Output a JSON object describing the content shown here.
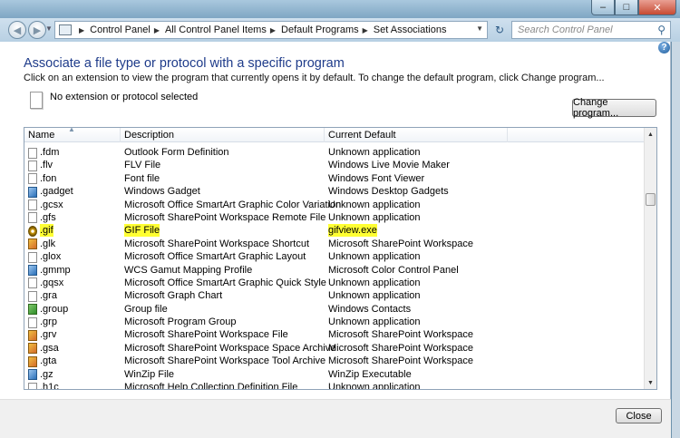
{
  "window": {
    "minimize_icon": "minimize-icon",
    "maximize_icon": "maximize-icon",
    "close_icon": "close-icon"
  },
  "address_bar": {
    "breadcrumbs": [
      "Control Panel",
      "All Control Panel Items",
      "Default Programs",
      "Set Associations"
    ],
    "search_placeholder": "Search Control Panel"
  },
  "page": {
    "heading": "Associate a file type or protocol with a specific program",
    "instructions": "Click on an extension to view the program that currently opens it by default. To change the default program, click Change program...",
    "selection_text": "No extension or protocol selected",
    "change_button": "Change program...",
    "close_button": "Close"
  },
  "list": {
    "columns": [
      "Name",
      "Description",
      "Current Default"
    ],
    "rows": [
      {
        "name": ".fdm",
        "description": "Outlook Form Definition",
        "default": "Unknown application",
        "icon": "plain"
      },
      {
        "name": ".flv",
        "description": "FLV File",
        "default": "Windows Live Movie Maker",
        "icon": "plain"
      },
      {
        "name": ".fon",
        "description": "Font file",
        "default": "Windows Font Viewer",
        "icon": "plain"
      },
      {
        "name": ".gadget",
        "description": "Windows Gadget",
        "default": "Windows Desktop Gadgets",
        "icon": "blue"
      },
      {
        "name": ".gcsx",
        "description": "Microsoft Office SmartArt Graphic Color Variation",
        "default": "Unknown application",
        "icon": "plain"
      },
      {
        "name": ".gfs",
        "description": "Microsoft SharePoint Workspace Remote File",
        "default": "Unknown application",
        "icon": "plain"
      },
      {
        "name": ".gif",
        "description": "GIF File",
        "default": "gifview.exe",
        "icon": "gif",
        "highlighted": true
      },
      {
        "name": ".glk",
        "description": "Microsoft SharePoint Workspace Shortcut",
        "default": "Microsoft SharePoint Workspace",
        "icon": "color"
      },
      {
        "name": ".glox",
        "description": "Microsoft Office SmartArt Graphic Layout",
        "default": "Unknown application",
        "icon": "plain"
      },
      {
        "name": ".gmmp",
        "description": "WCS Gamut Mapping Profile",
        "default": "Microsoft Color Control Panel",
        "icon": "blue"
      },
      {
        "name": ".gqsx",
        "description": "Microsoft Office SmartArt Graphic Quick Style",
        "default": "Unknown application",
        "icon": "plain"
      },
      {
        "name": ".gra",
        "description": "Microsoft Graph Chart",
        "default": "Unknown application",
        "icon": "plain"
      },
      {
        "name": ".group",
        "description": "Group file",
        "default": "Windows Contacts",
        "icon": "green"
      },
      {
        "name": ".grp",
        "description": "Microsoft Program Group",
        "default": "Unknown application",
        "icon": "plain"
      },
      {
        "name": ".grv",
        "description": "Microsoft SharePoint Workspace File",
        "default": "Microsoft SharePoint Workspace",
        "icon": "color"
      },
      {
        "name": ".gsa",
        "description": "Microsoft SharePoint Workspace Space Archive",
        "default": "Microsoft SharePoint Workspace",
        "icon": "color"
      },
      {
        "name": ".gta",
        "description": "Microsoft SharePoint Workspace Tool Archive",
        "default": "Microsoft SharePoint Workspace",
        "icon": "color"
      },
      {
        "name": ".gz",
        "description": "WinZip File",
        "default": "WinZip Executable",
        "icon": "blue"
      },
      {
        "name": ".h1c",
        "description": "Microsoft Help Collection Definition File",
        "default": "Unknown application",
        "icon": "plain",
        "cut": true
      }
    ]
  },
  "colors": {
    "heading": "#1e3b8a",
    "highlight": "#ffff33",
    "window_frame": "#6e93ad"
  }
}
